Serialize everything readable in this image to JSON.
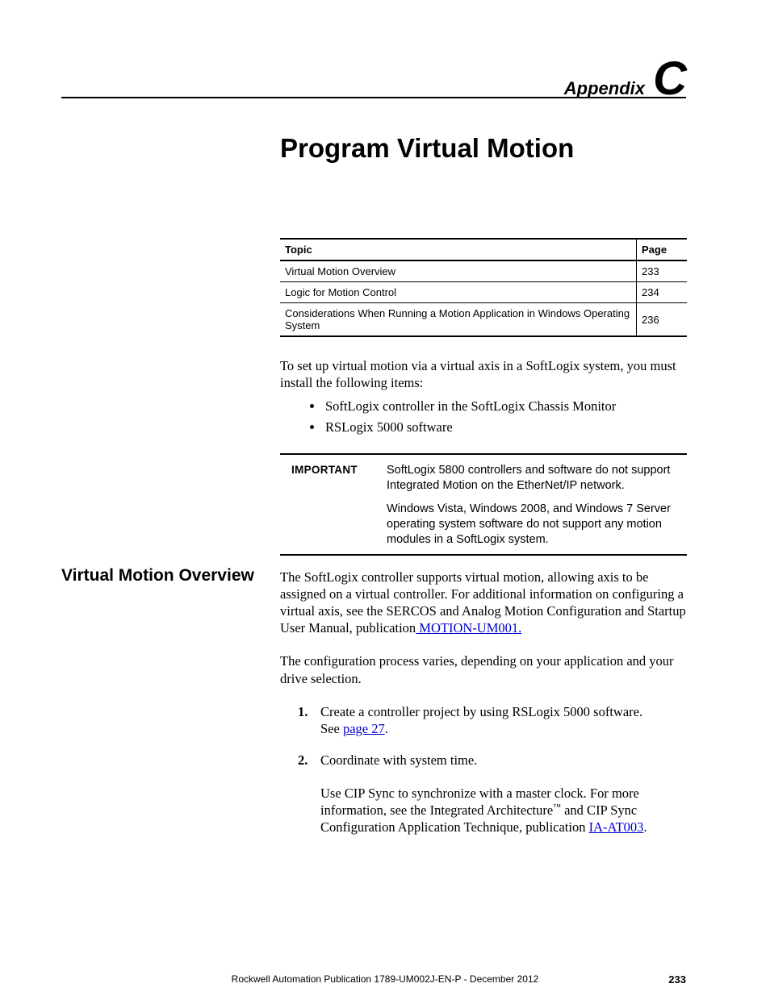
{
  "header": {
    "appendix_word": "Appendix",
    "appendix_letter": "C"
  },
  "chapter_title": "Program Virtual Motion",
  "topic_table": {
    "head_topic": "Topic",
    "head_page": "Page",
    "rows": [
      {
        "topic": "Virtual Motion Overview",
        "page": "233"
      },
      {
        "topic": "Logic for Motion Control",
        "page": "234"
      },
      {
        "topic": "Considerations When Running a Motion Application in Windows Operating System",
        "page": "236"
      }
    ]
  },
  "intro": {
    "para": "To set up virtual motion via a virtual axis in a SoftLogix system, you must install the following items:",
    "items": [
      "SoftLogix controller in the SoftLogix Chassis Monitor",
      "RSLogix 5000 software"
    ]
  },
  "important": {
    "label": "IMPORTANT",
    "p1": "SoftLogix 5800 controllers and software do not support Integrated Motion on the EtherNet/IP network.",
    "p2": "Windows Vista, Windows 2008, and Windows 7 Server operating system software do not support any motion modules in a SoftLogix system."
  },
  "section": {
    "heading": "Virtual Motion Overview",
    "p1_a": "The SoftLogix controller supports virtual motion, allowing axis to be assigned on a virtual controller. For additional information on configuring a virtual axis, see the SERCOS and Analog Motion Configuration and Startup User Manual, publication",
    "p1_link": " MOTION-UM001. ",
    "p2": "The configuration process varies, depending on your application and your drive selection.",
    "step1_a": "Create a controller project by using RSLogix 5000 software.",
    "step1_b_pre": "See ",
    "step1_b_link": "page 27",
    "step1_b_post": ".",
    "step2_a": "Coordinate with system time.",
    "step2_b_pre": "Use CIP Sync to synchronize with a master clock. For more information, see the Integrated Architecture",
    "step2_b_tm": "™",
    "step2_b_mid": " and CIP Sync Configuration Application Technique, publication ",
    "step2_b_link": "IA-AT003",
    "step2_b_post": "."
  },
  "footer": {
    "center": "Rockwell Automation Publication 1789-UM002J-EN-P - December 2012",
    "pageno": "233"
  }
}
